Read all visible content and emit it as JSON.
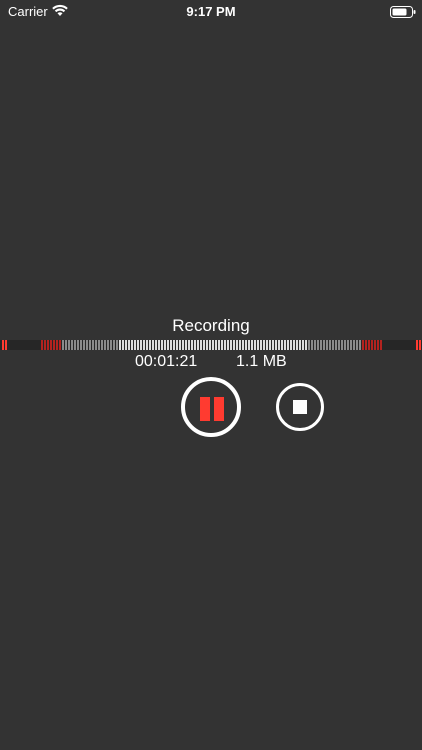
{
  "status_bar": {
    "carrier": "Carrier",
    "time": "9:17 PM",
    "wifi_icon": "wifi-icon",
    "battery_icon": "battery-icon"
  },
  "recorder": {
    "state_label": "Recording",
    "elapsed_time": "00:01:21",
    "file_size": "1.1 MB",
    "pause_icon": "pause-icon",
    "stop_icon": "stop-icon"
  },
  "colors": {
    "background": "#333333",
    "accent_red": "#ff3b30",
    "meter_peak_red": "#b3231f",
    "meter_active": "#dcdcdc",
    "meter_inactive": "#8a8a8a",
    "meter_empty": "#262626"
  }
}
